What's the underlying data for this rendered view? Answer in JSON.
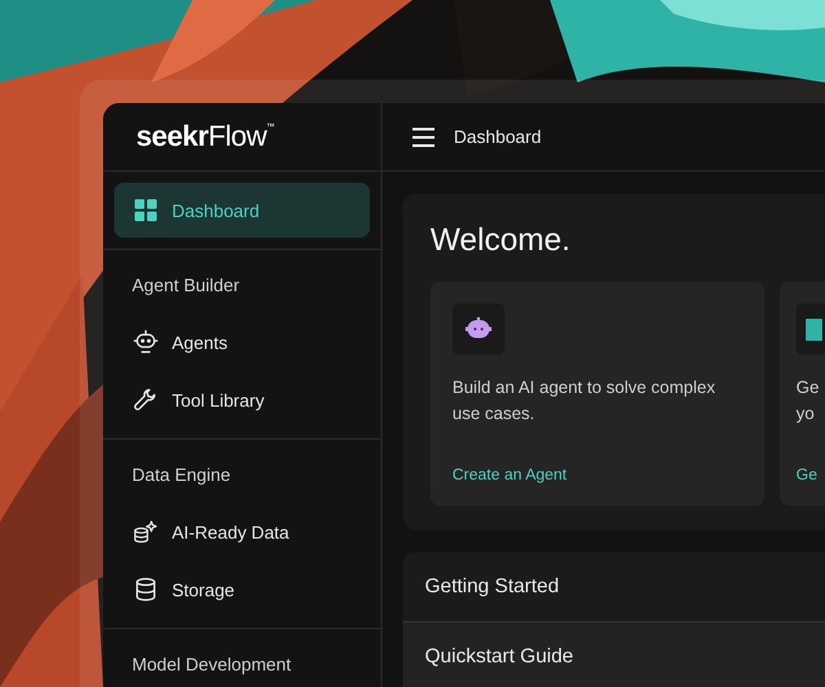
{
  "logo": "**seekr**Flow$^{™}$",
  "sidebar": {
    "sections": [
      {
        "items": [
          {
            "label": "Dashboard",
            "selected": true
          }
        ]
      },
      {
        "title": "Agent Builder",
        "items": [
          {
            "label": "Agents",
            "selected": false
          },
          {
            "label": "Tool Library",
            "selected": false
          }
        ]
      },
      {
        "title": "Data Engine",
        "items": [
          {
            "label": "AI-Ready Data",
            "selected": false
          },
          {
            "label": "Storage",
            "selected": false
          }
        ]
      },
      {
        "title": "Model Development"
      }
    ]
  },
  "header": {
    "title": "Dashboard"
  },
  "welcome": {
    "title": "Welcome.",
    "cards": [
      {
        "text": "Build an AI agent to solve complex use cases.",
        "link": "Create an Agent"
      },
      {
        "text": "Ge\nyo",
        "link": "Ge"
      }
    ]
  },
  "getting_started": {
    "title": "Getting Started",
    "rows": [
      "Quickstart Guide"
    ]
  }
}
